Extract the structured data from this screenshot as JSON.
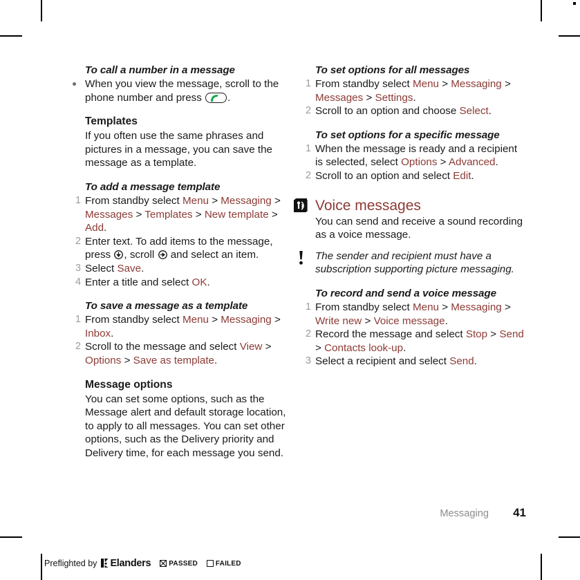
{
  "colors": {
    "menu_accent": "#8c3b36",
    "body_text": "#1a1a1a",
    "list_number": "#9b9b9b",
    "footer_chapter": "#8c8c8c",
    "call_key_green": "#11a74a"
  },
  "left_column": {
    "task_call_number": {
      "heading": "To call a number in a message",
      "bullet_text_before": "When you view the message, scroll to the phone number and press",
      "bullet_text_after": "."
    },
    "templates": {
      "heading": "Templates",
      "body": "If you often use the same phrases and pictures in a message, you can save the message as a template."
    },
    "task_add_template": {
      "heading": "To add a message template",
      "steps": [
        {
          "parts": [
            {
              "t": "From standby select ",
              "c": "plain"
            },
            {
              "t": "Menu",
              "c": "menu"
            },
            {
              "t": " > ",
              "c": "plain"
            },
            {
              "t": "Messaging",
              "c": "menu"
            },
            {
              "t": " > ",
              "c": "plain"
            },
            {
              "t": "Messages",
              "c": "menu"
            },
            {
              "t": " > ",
              "c": "plain"
            },
            {
              "t": "Templates",
              "c": "menu"
            },
            {
              "t": " > ",
              "c": "plain"
            },
            {
              "t": "New template",
              "c": "menu"
            },
            {
              "t": " > ",
              "c": "plain"
            },
            {
              "t": "Add",
              "c": "menu"
            },
            {
              "t": ".",
              "c": "plain"
            }
          ]
        },
        {
          "prefix": "Enter text. To add items to the message, press",
          "middle": ", scroll",
          "suffix": "and select an item."
        },
        {
          "parts": [
            {
              "t": "Select ",
              "c": "plain"
            },
            {
              "t": "Save",
              "c": "menu"
            },
            {
              "t": ".",
              "c": "plain"
            }
          ]
        },
        {
          "parts": [
            {
              "t": "Enter a title and select ",
              "c": "plain"
            },
            {
              "t": "OK",
              "c": "menu"
            },
            {
              "t": ".",
              "c": "plain"
            }
          ]
        }
      ]
    },
    "task_save_template": {
      "heading": "To save a message as a template",
      "steps": [
        {
          "parts": [
            {
              "t": "From standby select ",
              "c": "plain"
            },
            {
              "t": "Menu",
              "c": "menu"
            },
            {
              "t": " > ",
              "c": "plain"
            },
            {
              "t": "Messaging",
              "c": "menu"
            },
            {
              "t": " > ",
              "c": "plain"
            },
            {
              "t": "Inbox",
              "c": "menu"
            },
            {
              "t": ".",
              "c": "plain"
            }
          ]
        },
        {
          "parts": [
            {
              "t": "Scroll to the message and select ",
              "c": "plain"
            },
            {
              "t": "View",
              "c": "menu"
            },
            {
              "t": " > ",
              "c": "plain"
            },
            {
              "t": "Options",
              "c": "menu"
            },
            {
              "t": " > ",
              "c": "plain"
            },
            {
              "t": "Save as template",
              "c": "menu"
            },
            {
              "t": ".",
              "c": "plain"
            }
          ]
        }
      ]
    },
    "message_options": {
      "heading": "Message options",
      "body": "You can set some options, such as the Message alert and default storage location, to apply to all messages. You can set other options, such as the Delivery priority and Delivery time, for each message you send."
    }
  },
  "right_column": {
    "task_options_all": {
      "heading": "To set options for all messages",
      "steps": [
        {
          "parts": [
            {
              "t": "From standby select ",
              "c": "plain"
            },
            {
              "t": "Menu",
              "c": "menu"
            },
            {
              "t": " > ",
              "c": "plain"
            },
            {
              "t": "Messaging",
              "c": "menu"
            },
            {
              "t": " > ",
              "c": "plain"
            },
            {
              "t": "Messages",
              "c": "menu"
            },
            {
              "t": " > ",
              "c": "plain"
            },
            {
              "t": "Settings",
              "c": "menu"
            },
            {
              "t": ".",
              "c": "plain"
            }
          ]
        },
        {
          "parts": [
            {
              "t": "Scroll to an option and choose ",
              "c": "plain"
            },
            {
              "t": "Select",
              "c": "menu"
            },
            {
              "t": ".",
              "c": "plain"
            }
          ]
        }
      ]
    },
    "task_options_specific": {
      "heading": "To set options for a specific message",
      "steps": [
        {
          "parts": [
            {
              "t": "When the message is ready and a recipient is selected, select ",
              "c": "plain"
            },
            {
              "t": "Options",
              "c": "menu"
            },
            {
              "t": " > ",
              "c": "plain"
            },
            {
              "t": "Advanced",
              "c": "menu"
            },
            {
              "t": ".",
              "c": "plain"
            }
          ]
        },
        {
          "parts": [
            {
              "t": "Scroll to an option and select ",
              "c": "plain"
            },
            {
              "t": "Edit",
              "c": "menu"
            },
            {
              "t": ".",
              "c": "plain"
            }
          ]
        }
      ]
    },
    "voice_messages": {
      "chapter_title": "Voice messages",
      "intro": "You can send and receive a sound recording as a voice message.",
      "note": "The sender and recipient must have a subscription supporting picture messaging."
    },
    "task_record_voice": {
      "heading": "To record and send a voice message",
      "steps": [
        {
          "parts": [
            {
              "t": "From standby select ",
              "c": "plain"
            },
            {
              "t": "Menu",
              "c": "menu"
            },
            {
              "t": " > ",
              "c": "plain"
            },
            {
              "t": "Messaging",
              "c": "menu"
            },
            {
              "t": " > ",
              "c": "plain"
            },
            {
              "t": "Write new",
              "c": "menu"
            },
            {
              "t": " > ",
              "c": "plain"
            },
            {
              "t": "Voice message",
              "c": "menu"
            },
            {
              "t": ".",
              "c": "plain"
            }
          ]
        },
        {
          "parts": [
            {
              "t": "Record the message and select ",
              "c": "plain"
            },
            {
              "t": "Stop",
              "c": "menu"
            },
            {
              "t": " > ",
              "c": "plain"
            },
            {
              "t": "Send",
              "c": "menu"
            },
            {
              "t": " > ",
              "c": "plain"
            },
            {
              "t": "Contacts look-up",
              "c": "menu"
            },
            {
              "t": ".",
              "c": "plain"
            }
          ]
        },
        {
          "parts": [
            {
              "t": "Select a recipient and select ",
              "c": "plain"
            },
            {
              "t": "Send",
              "c": "menu"
            },
            {
              "t": ".",
              "c": "plain"
            }
          ]
        }
      ]
    }
  },
  "footer": {
    "chapter": "Messaging",
    "page_number": "41"
  },
  "preflight": {
    "label": "Preflighted by",
    "brand": "Elanders",
    "passed": "PASSED",
    "failed": "FAILED"
  },
  "icons": {
    "call_key": "call-key-icon",
    "scroll_down_key": "scroll-down-key-icon",
    "scroll_right_key": "scroll-right-key-icon",
    "voice_message_chapter": "voice-message-icon",
    "note_exclamation": "note-exclamation-icon"
  }
}
